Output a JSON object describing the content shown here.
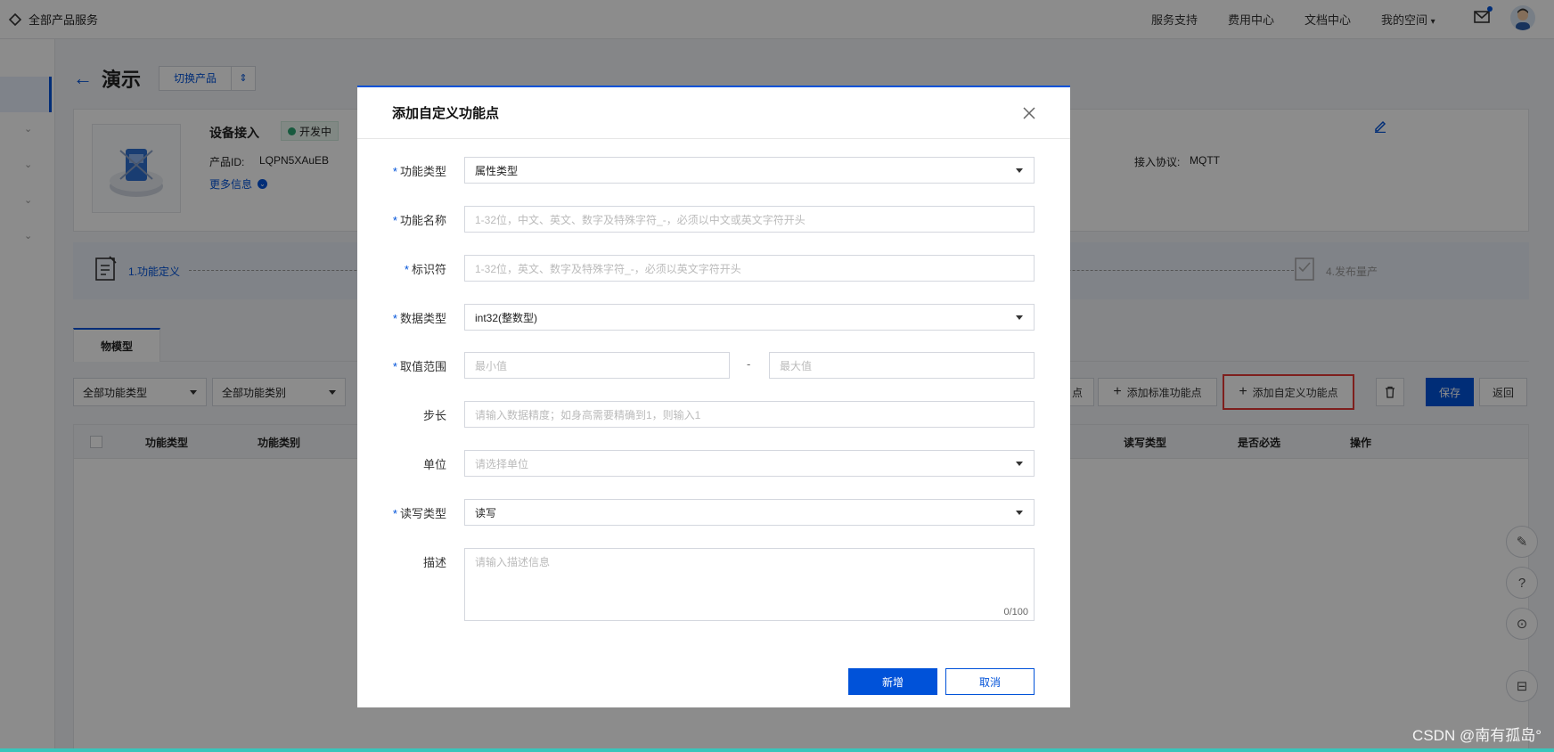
{
  "topbar": {
    "brand": "全部产品服务",
    "nav": [
      "服务支持",
      "费用中心",
      "文档中心",
      "我的空间"
    ]
  },
  "product": {
    "title": "演示",
    "switch_label": "切换产品",
    "section": "设备接入",
    "status": "开发中",
    "id_label": "产品ID:",
    "id_value": "LQPN5XAuEB",
    "more_info": "更多信息",
    "partial_text": "备",
    "protocol_label": "接入协议:",
    "protocol_value": "MQTT"
  },
  "steps": {
    "step1": "1.功能定义",
    "step4": "4.发布量产"
  },
  "tabs": {
    "thing_model": "物模型"
  },
  "toolbar": {
    "filter_type": "全部功能类型",
    "filter_category": "全部功能类别",
    "partial_btn": "点",
    "add_standard": "添加标准功能点",
    "add_custom": "添加自定义功能点",
    "save": "保存",
    "back": "返回"
  },
  "table": {
    "columns": [
      "功能类型",
      "功能类别",
      "读写类型",
      "是否必选",
      "操作"
    ]
  },
  "modal": {
    "title": "添加自定义功能点",
    "fields": {
      "func_type": {
        "label": "功能类型",
        "value": "属性类型"
      },
      "func_name": {
        "label": "功能名称",
        "placeholder": "1-32位，中文、英文、数字及特殊字符_-，必须以中文或英文字符开头"
      },
      "identifier": {
        "label": "标识符",
        "placeholder": "1-32位，英文、数字及特殊字符_-，必须以英文字符开头"
      },
      "data_type": {
        "label": "数据类型",
        "value": "int32(整数型)"
      },
      "range": {
        "label": "取值范围",
        "min_placeholder": "最小值",
        "sep": "-",
        "max_placeholder": "最大值"
      },
      "step": {
        "label": "步长",
        "placeholder": "请输入数据精度；如身高需要精确到1，则输入1"
      },
      "unit": {
        "label": "单位",
        "placeholder": "请选择单位"
      },
      "rw_type": {
        "label": "读写类型",
        "value": "读写"
      },
      "desc": {
        "label": "描述",
        "placeholder": "请输入描述信息",
        "counter": "0/100"
      }
    },
    "submit": "新增",
    "cancel": "取消"
  },
  "watermark": "CSDN @南有孤岛°",
  "colors": {
    "primary": "#0052d9",
    "highlight": "#e53935",
    "status_green": "#2ba471"
  }
}
